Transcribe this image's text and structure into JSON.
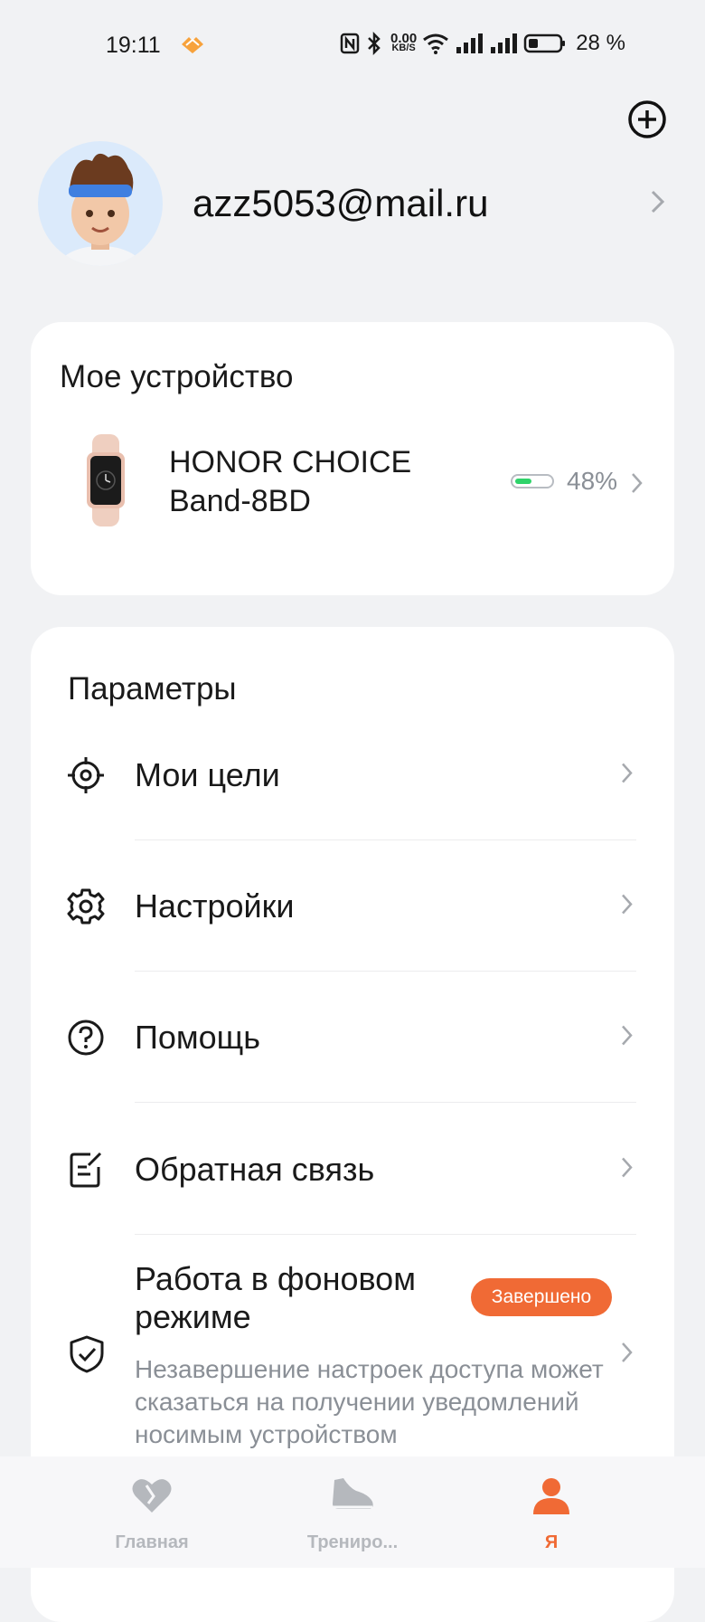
{
  "status_bar": {
    "time": "19:11",
    "net_speed_value": "0.00",
    "net_speed_unit": "KB/S",
    "battery": "28 %"
  },
  "account": {
    "email": "azz5053@mail.ru"
  },
  "device_section": {
    "title": "Мое устройство",
    "device_name": "HONOR CHOICE Band-8BD",
    "battery_level": "48%",
    "battery_fraction": 0.48
  },
  "params_section": {
    "title": "Параметры",
    "items": [
      {
        "label": "Мои цели",
        "icon": "target-icon"
      },
      {
        "label": "Настройки",
        "icon": "gear-icon"
      },
      {
        "label": "Помощь",
        "icon": "help-icon"
      },
      {
        "label": "Обратная связь",
        "icon": "feedback-icon"
      }
    ],
    "background": {
      "title": "Работа в фоновом режиме",
      "badge": "Завершено",
      "description": "Незавершение настроек доступа может сказаться на получении уведомлений носимым устройством",
      "icon": "shield-check-icon"
    }
  },
  "tabs": [
    {
      "label": "Главная",
      "icon": "heart-icon",
      "active": false
    },
    {
      "label": "Трениро...",
      "icon": "shoe-icon",
      "active": false
    },
    {
      "label": "Я",
      "icon": "person-icon",
      "active": true
    }
  ],
  "colors": {
    "accent": "#f06a35",
    "background": "#f1f2f4",
    "battery_fill": "#2fd36a"
  }
}
